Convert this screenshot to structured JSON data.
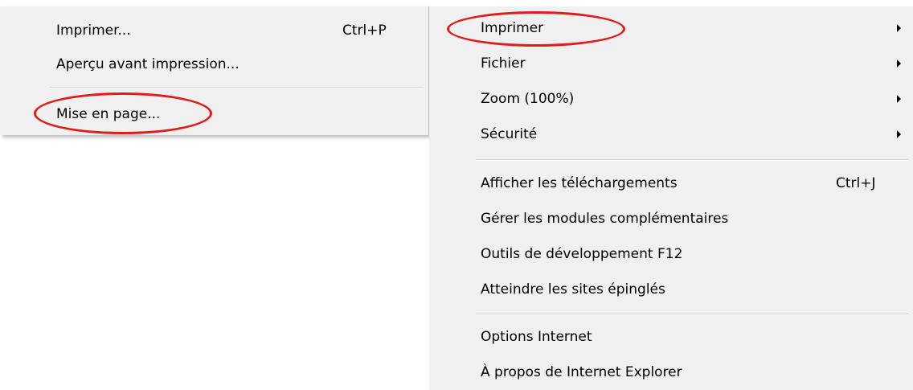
{
  "print_submenu": {
    "items": [
      {
        "label": "Imprimer...",
        "shortcut": "Ctrl+P"
      },
      {
        "label": "Aperçu avant impression...",
        "shortcut": ""
      },
      {
        "label": "Mise en page...",
        "shortcut": ""
      }
    ]
  },
  "tools_menu": {
    "items": [
      {
        "label": "Imprimer",
        "shortcut": "",
        "submenu": true
      },
      {
        "label": "Fichier",
        "shortcut": "",
        "submenu": true
      },
      {
        "label": "Zoom (100%)",
        "shortcut": "",
        "submenu": true
      },
      {
        "label": "Sécurité",
        "shortcut": "",
        "submenu": true
      },
      {
        "label": "Afficher les téléchargements",
        "shortcut": "Ctrl+J",
        "submenu": false
      },
      {
        "label": "Gérer les modules complémentaires",
        "shortcut": "",
        "submenu": false
      },
      {
        "label": "Outils de développement F12",
        "shortcut": "",
        "submenu": false
      },
      {
        "label": "Atteindre les sites épinglés",
        "shortcut": "",
        "submenu": false
      },
      {
        "label": "Options Internet",
        "shortcut": "",
        "submenu": false
      },
      {
        "label": "À propos de Internet Explorer",
        "shortcut": "",
        "submenu": false
      }
    ]
  },
  "annotation_color": "#e31b1b"
}
